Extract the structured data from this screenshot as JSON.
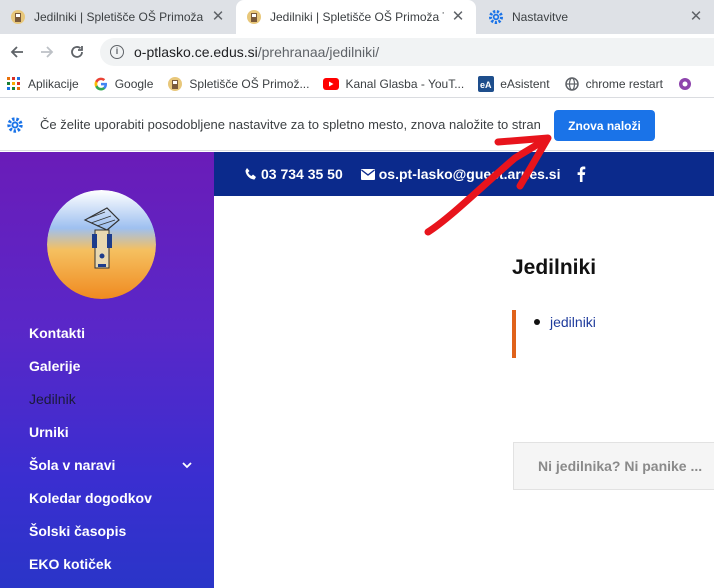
{
  "browser": {
    "tabs": [
      {
        "title": "Jedilniki | Spletišče OŠ Primoža Tr",
        "active": false,
        "favicon": "school-logo-icon"
      },
      {
        "title": "Jedilniki | Spletišče OŠ Primoža Tr",
        "active": true,
        "favicon": "school-logo-icon"
      },
      {
        "title": "Nastavitve",
        "active": false,
        "favicon": "gear-icon"
      }
    ],
    "close_glyph": "✕",
    "url_host": "o-ptlasko.ce.edus.si",
    "url_path": "/prehranaa/jedilniki/",
    "bookmarks": [
      {
        "label": "Aplikacije",
        "icon": "apps-grid-icon"
      },
      {
        "label": "Google",
        "icon": "google-icon"
      },
      {
        "label": "Spletišče OŠ Primož...",
        "icon": "school-logo-icon"
      },
      {
        "label": "Kanal Glasba - YouT...",
        "icon": "youtube-icon"
      },
      {
        "label": "eAsistent",
        "icon": "easistent-icon"
      },
      {
        "label": "chrome restart",
        "icon": "globe-icon"
      }
    ]
  },
  "infobar": {
    "message": "Če želite uporabiti posodobljene nastavitve za to spletno mesto, znova naložite to stran",
    "button_label": "Znova naloži",
    "accent": "#1a73e8"
  },
  "site": {
    "phone": "03 734 35 50",
    "email": "os.pt-lasko@guest.arnes.si",
    "menu": [
      {
        "label": "Kontakti"
      },
      {
        "label": "Galerije"
      },
      {
        "label": "Jedilnik",
        "current": true
      },
      {
        "label": "Urniki"
      },
      {
        "label": "Šola v naravi",
        "has_submenu": true
      },
      {
        "label": "Koledar dogodkov"
      },
      {
        "label": "Šolski časopis"
      },
      {
        "label": "EKO kotiček"
      }
    ],
    "page_title": "Jedilniki",
    "list_items": [
      "jedilniki"
    ],
    "notice_text": "Ni jedilnika? Ni panike ...",
    "colors": {
      "sidebar_top": "#6a1cb8",
      "sidebar_bottom": "#2a35c8",
      "topbar": "#0b2a8c",
      "accent_border": "#e0621a",
      "annotation_arrow": "#e8141c"
    }
  }
}
